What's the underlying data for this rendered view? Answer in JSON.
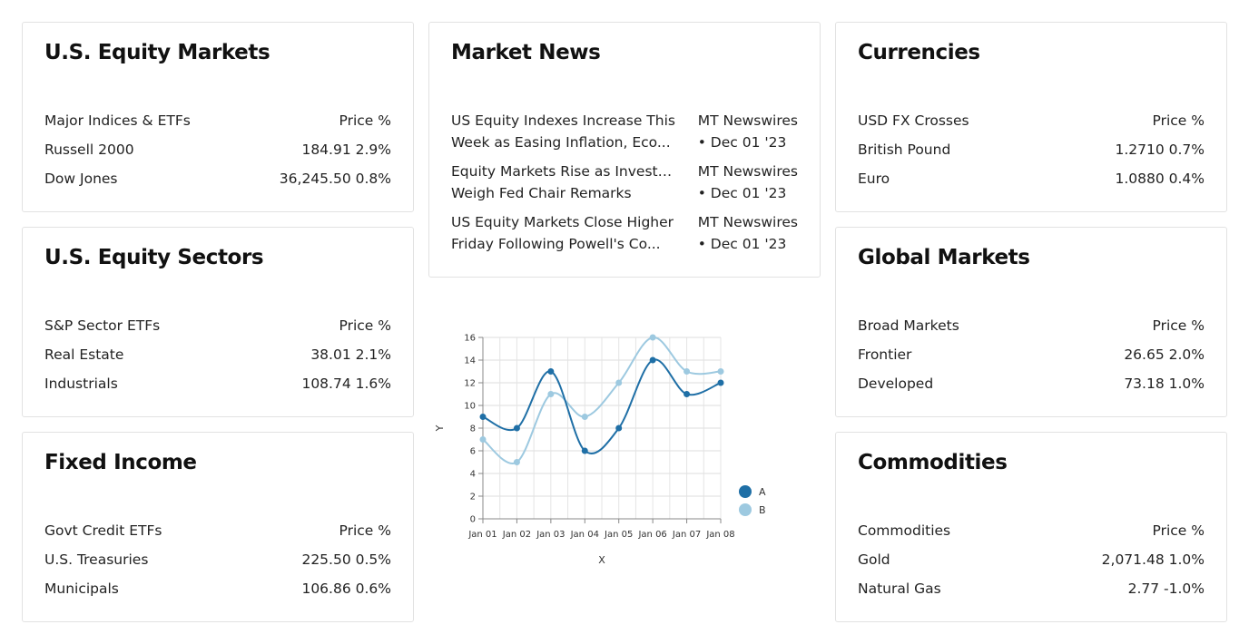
{
  "us_equity_markets": {
    "title": "U.S. Equity Markets",
    "header": {
      "label": "Major Indices & ETFs",
      "value": "Price %"
    },
    "rows": [
      {
        "label": "Russell 2000",
        "value": "184.91 2.9%"
      },
      {
        "label": "Dow Jones",
        "value": "36,245.50 0.8%"
      }
    ]
  },
  "us_equity_sectors": {
    "title": "U.S. Equity Sectors",
    "header": {
      "label": "S&P Sector ETFs",
      "value": "Price %"
    },
    "rows": [
      {
        "label": "Real Estate",
        "value": "38.01 2.1%"
      },
      {
        "label": "Industrials",
        "value": "108.74 1.6%"
      }
    ]
  },
  "fixed_income": {
    "title": "Fixed Income",
    "header": {
      "label": "Govt Credit ETFs",
      "value": "Price %"
    },
    "rows": [
      {
        "label": "U.S. Treasuries",
        "value": "225.50 0.5%"
      },
      {
        "label": "Municipals",
        "value": "106.86 0.6%"
      }
    ]
  },
  "market_news": {
    "title": "Market News",
    "items": [
      {
        "line1": "US Equity Indexes Increase This",
        "line2": "Week as Easing Inflation, Eco...",
        "source": "MT Newswires",
        "date": "• Dec 01 '23"
      },
      {
        "line1": "Equity Markets Rise as Investors",
        "line2": "Weigh Fed Chair Remarks",
        "source": "MT Newswires",
        "date": "• Dec 01 '23"
      },
      {
        "line1": "US Equity Markets Close Higher",
        "line2": "Friday Following Powell's Co...",
        "source": "MT Newswires",
        "date": "• Dec 01 '23"
      }
    ]
  },
  "currencies": {
    "title": "Currencies",
    "header": {
      "label": "USD FX Crosses",
      "value": "Price %"
    },
    "rows": [
      {
        "label": "British Pound",
        "value": "1.2710 0.7%"
      },
      {
        "label": "Euro",
        "value": "1.0880 0.4%"
      }
    ]
  },
  "global_markets": {
    "title": "Global Markets",
    "header": {
      "label": "Broad Markets",
      "value": "Price %"
    },
    "rows": [
      {
        "label": "Frontier",
        "value": "26.65 2.0%"
      },
      {
        "label": "Developed",
        "value": "73.18 1.0%"
      }
    ]
  },
  "commodities": {
    "title": "Commodities",
    "header": {
      "label": "Commodities",
      "value": "Price %"
    },
    "rows": [
      {
        "label": "Gold",
        "value": "2,071.48 1.0%"
      },
      {
        "label": "Natural Gas",
        "value": "2.77 -1.0%"
      }
    ]
  },
  "chart_data": {
    "type": "line",
    "xlabel": "X",
    "ylabel": "Y",
    "ylim": [
      0,
      16
    ],
    "yticks": [
      0,
      2,
      4,
      6,
      8,
      10,
      12,
      14,
      16
    ],
    "categories": [
      "Jan 01",
      "Jan 02",
      "Jan 03",
      "Jan 04",
      "Jan 05",
      "Jan 06",
      "Jan 07",
      "Jan 08"
    ],
    "grid": true,
    "legend_position": "bottom-right",
    "series": [
      {
        "name": "A",
        "color": "#1f6fa6",
        "values": [
          9,
          8,
          13,
          6,
          8,
          14,
          11,
          12
        ]
      },
      {
        "name": "B",
        "color": "#9dc9e0",
        "values": [
          7,
          5,
          11,
          9,
          12,
          16,
          13,
          13
        ]
      }
    ]
  }
}
